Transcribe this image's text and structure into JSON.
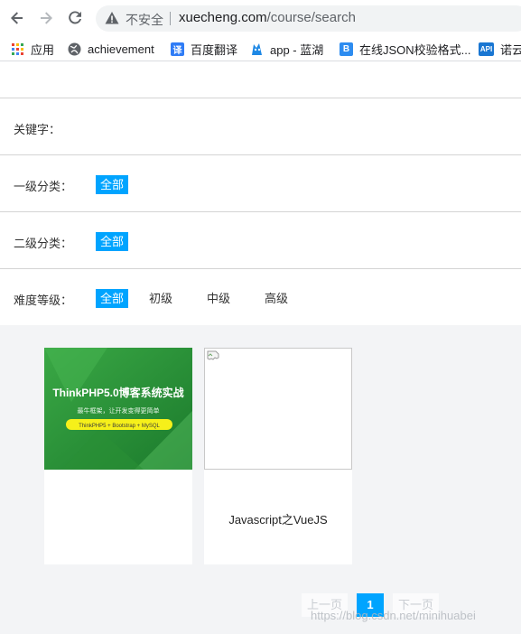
{
  "browser": {
    "insecure_label": "不安全",
    "url_host": "xuecheng.com",
    "url_path": "/course/search",
    "bookmarks": [
      {
        "label": "应用",
        "icon": "apps-grid-icon"
      },
      {
        "label": "achievement",
        "icon": "globe-icon"
      },
      {
        "label": "百度翻译",
        "icon": "translate-icon",
        "glyph": "译"
      },
      {
        "label": "app - 蓝湖",
        "icon": "lanhu-icon"
      },
      {
        "label": "在线JSON校验格式...",
        "icon": "bejson-icon",
        "glyph": "B"
      },
      {
        "label": "诺云",
        "icon": "api-icon",
        "glyph": "API"
      }
    ]
  },
  "filters": {
    "keyword_label": "关键字：",
    "level1_label": "一级分类：",
    "level2_label": "二级分类：",
    "difficulty_label": "难度等级：",
    "all_label": "全部",
    "difficulty_options": [
      "初级",
      "中级",
      "高级"
    ]
  },
  "courses": [
    {
      "title": "",
      "image": {
        "headline": "ThinkPHP5.0博客系统实战",
        "tagline": "最牛框架，让开发变得更简单",
        "stack": "ThinkPHP5 + Bootstrap + MySQL"
      }
    },
    {
      "title": "Javascript之VueJS",
      "image": null
    }
  ],
  "pagination": {
    "prev_label": "上一页",
    "current_page": "1",
    "next_label": "下一页"
  },
  "watermark": "https://blog.csdn.net/minihuabei",
  "colors": {
    "accent": "#00a4ff",
    "card_image_green": "#2f9e3e"
  }
}
